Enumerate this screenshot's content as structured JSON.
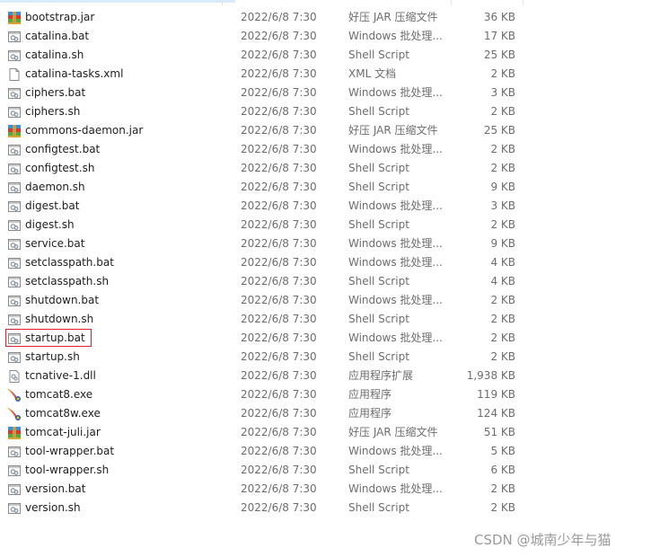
{
  "colors": {
    "highlight_border": "#e0202a",
    "secondary_text": "#6d6d6d"
  },
  "files": [
    {
      "name": "bootstrap.jar",
      "date": "2022/6/8 7:30",
      "type": "好压 JAR 压缩文件",
      "size": "36 KB",
      "icon": "archive-icon"
    },
    {
      "name": "catalina.bat",
      "date": "2022/6/8 7:30",
      "type": "Windows 批处理...",
      "size": "17 KB",
      "icon": "script-icon"
    },
    {
      "name": "catalina.sh",
      "date": "2022/6/8 7:30",
      "type": "Shell Script",
      "size": "25 KB",
      "icon": "script-icon"
    },
    {
      "name": "catalina-tasks.xml",
      "date": "2022/6/8 7:30",
      "type": "XML 文档",
      "size": "2 KB",
      "icon": "document-icon"
    },
    {
      "name": "ciphers.bat",
      "date": "2022/6/8 7:30",
      "type": "Windows 批处理...",
      "size": "3 KB",
      "icon": "script-icon"
    },
    {
      "name": "ciphers.sh",
      "date": "2022/6/8 7:30",
      "type": "Shell Script",
      "size": "2 KB",
      "icon": "script-icon"
    },
    {
      "name": "commons-daemon.jar",
      "date": "2022/6/8 7:30",
      "type": "好压 JAR 压缩文件",
      "size": "25 KB",
      "icon": "archive-icon"
    },
    {
      "name": "configtest.bat",
      "date": "2022/6/8 7:30",
      "type": "Windows 批处理...",
      "size": "2 KB",
      "icon": "script-icon"
    },
    {
      "name": "configtest.sh",
      "date": "2022/6/8 7:30",
      "type": "Shell Script",
      "size": "2 KB",
      "icon": "script-icon"
    },
    {
      "name": "daemon.sh",
      "date": "2022/6/8 7:30",
      "type": "Shell Script",
      "size": "9 KB",
      "icon": "script-icon"
    },
    {
      "name": "digest.bat",
      "date": "2022/6/8 7:30",
      "type": "Windows 批处理...",
      "size": "3 KB",
      "icon": "script-icon"
    },
    {
      "name": "digest.sh",
      "date": "2022/6/8 7:30",
      "type": "Shell Script",
      "size": "2 KB",
      "icon": "script-icon"
    },
    {
      "name": "service.bat",
      "date": "2022/6/8 7:30",
      "type": "Windows 批处理...",
      "size": "9 KB",
      "icon": "script-icon"
    },
    {
      "name": "setclasspath.bat",
      "date": "2022/6/8 7:30",
      "type": "Windows 批处理...",
      "size": "4 KB",
      "icon": "script-icon"
    },
    {
      "name": "setclasspath.sh",
      "date": "2022/6/8 7:30",
      "type": "Shell Script",
      "size": "4 KB",
      "icon": "script-icon"
    },
    {
      "name": "shutdown.bat",
      "date": "2022/6/8 7:30",
      "type": "Windows 批处理...",
      "size": "2 KB",
      "icon": "script-icon"
    },
    {
      "name": "shutdown.sh",
      "date": "2022/6/8 7:30",
      "type": "Shell Script",
      "size": "2 KB",
      "icon": "script-icon"
    },
    {
      "name": "startup.bat",
      "date": "2022/6/8 7:30",
      "type": "Windows 批处理...",
      "size": "2 KB",
      "icon": "script-icon",
      "highlighted": true
    },
    {
      "name": "startup.sh",
      "date": "2022/6/8 7:30",
      "type": "Shell Script",
      "size": "2 KB",
      "icon": "script-icon"
    },
    {
      "name": "tcnative-1.dll",
      "date": "2022/6/8 7:30",
      "type": "应用程序扩展",
      "size": "1,938 KB",
      "icon": "dll-icon"
    },
    {
      "name": "tomcat8.exe",
      "date": "2022/6/8 7:30",
      "type": "应用程序",
      "size": "119 KB",
      "icon": "tomcat-feather-icon"
    },
    {
      "name": "tomcat8w.exe",
      "date": "2022/6/8 7:30",
      "type": "应用程序",
      "size": "124 KB",
      "icon": "tomcat-feather-icon"
    },
    {
      "name": "tomcat-juli.jar",
      "date": "2022/6/8 7:30",
      "type": "好压 JAR 压缩文件",
      "size": "51 KB",
      "icon": "archive-icon"
    },
    {
      "name": "tool-wrapper.bat",
      "date": "2022/6/8 7:30",
      "type": "Windows 批处理...",
      "size": "5 KB",
      "icon": "script-icon"
    },
    {
      "name": "tool-wrapper.sh",
      "date": "2022/6/8 7:30",
      "type": "Shell Script",
      "size": "6 KB",
      "icon": "script-icon"
    },
    {
      "name": "version.bat",
      "date": "2022/6/8 7:30",
      "type": "Windows 批处理...",
      "size": "2 KB",
      "icon": "script-icon"
    },
    {
      "name": "version.sh",
      "date": "2022/6/8 7:30",
      "type": "Shell Script",
      "size": "2 KB",
      "icon": "script-icon"
    }
  ],
  "watermark": "CSDN @城南少年与猫"
}
